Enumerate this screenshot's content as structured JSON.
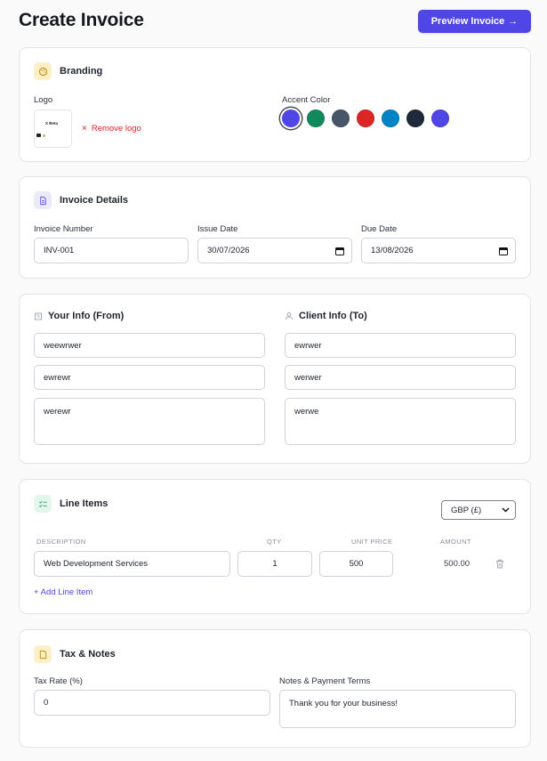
{
  "header": {
    "title": "Create Invoice",
    "preview_label": "Preview Invoice",
    "preview_arrow": "→"
  },
  "branding": {
    "title": "Branding",
    "logo_label": "Logo",
    "logo_text": "X Beta",
    "remove_label": "Remove logo",
    "accent_label": "Accent Color",
    "colors": [
      "#4f46e5",
      "#10895c",
      "#475569",
      "#dc2626",
      "#0284c7",
      "#1e293b",
      "#4f46e5"
    ],
    "selected_color_index": 0
  },
  "details": {
    "title": "Invoice Details",
    "number_label": "Invoice Number",
    "number_value": "INV-001",
    "issue_label": "Issue Date",
    "issue_value": "30/07/2026",
    "due_label": "Due Date",
    "due_value": "13/08/2026"
  },
  "parties": {
    "from_title": "Your Info (From)",
    "to_title": "Client Info (To)",
    "from": [
      "weewrwer",
      "ewrewr",
      "werewr"
    ],
    "to": [
      "ewrwer",
      "werwer",
      "werwe"
    ]
  },
  "line_items": {
    "title": "Line Items",
    "currency": "GBP (£)",
    "columns": {
      "description": "DESCRIPTION",
      "qty": "QTY",
      "unit_price": "UNIT PRICE",
      "amount": "AMOUNT"
    },
    "rows": [
      {
        "description": "Web Development Services",
        "qty": "1",
        "unit_price": "500",
        "amount": "500.00"
      }
    ],
    "add_label": "+ Add Line Item"
  },
  "tax_notes": {
    "title": "Tax & Notes",
    "tax_label": "Tax Rate (%)",
    "tax_value": "0",
    "notes_label": "Notes & Payment Terms",
    "notes_value": "Thank you for your business!"
  }
}
